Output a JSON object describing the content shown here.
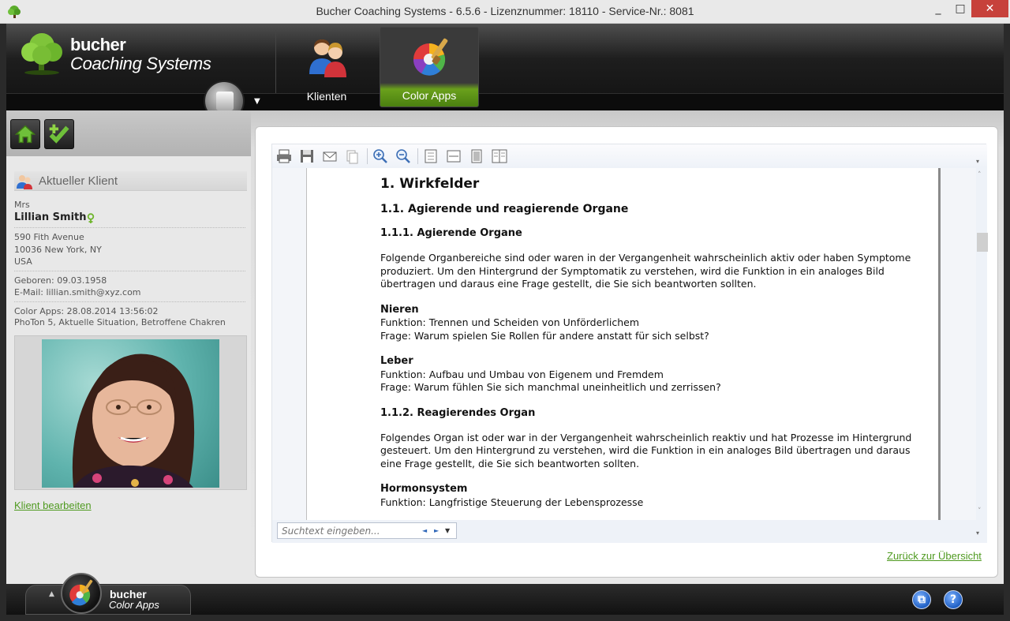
{
  "window": {
    "title": "Bucher Coaching Systems - 6.5.6 - Lizenznummer: 18110 - Service-Nr.: 8081",
    "minimize": "_",
    "maximize": "□",
    "close": "✕"
  },
  "header": {
    "logo_line1": "bucher",
    "logo_line2": "Coaching Systems",
    "system_menu_arrow": "▼",
    "tabs": [
      {
        "label": "Klienten",
        "icon": "clients-icon"
      },
      {
        "label": "Color Apps",
        "icon": "color-palette-icon",
        "active": true
      }
    ]
  },
  "sidebar": {
    "section_title": "Aktueller Klient",
    "client": {
      "salutation": "Mrs",
      "name": "Lillian Smith",
      "street": "590 Fith Avenue",
      "city": "10036 New York, NY",
      "country": "USA",
      "born": "Geboren: 09.03.1958",
      "email": "E-Mail: lillian.smith@xyz.com",
      "color_apps": "Color Apps: 28.08.2014 13:56:02",
      "color_apps_detail": "PhoTon 5, Aktuelle Situation, Betroffene Chakren"
    },
    "edit_link": "Klient bearbeiten"
  },
  "toolbar": {
    "buttons": [
      "print-icon",
      "save-icon",
      "mail-icon",
      "copy-icon",
      "zoom-in-icon",
      "zoom-out-icon",
      "fit-page-icon",
      "fit-width-icon",
      "single-page-icon",
      "two-pages-icon"
    ]
  },
  "document": {
    "h1": "1. Wirkfelder",
    "h2": "1.1. Agierende und reagierende Organe",
    "h3a": "1.1.1. Agierende Organe",
    "p1": "Folgende Organbereiche sind oder waren in der Vergangenheit wahrscheinlich aktiv oder haben Symptome produziert. Um den Hintergrund der Symptomatik zu verstehen, wird die Funktion in ein analoges Bild übertragen und daraus eine Frage gestellt, die Sie sich beantworten sollten.",
    "nieren_head": "Nieren",
    "nieren_func": "Funktion: Trennen und Scheiden von Unförderlichem",
    "nieren_q": "Frage: Warum spielen Sie Rollen für andere anstatt für sich selbst?",
    "leber_head": "Leber",
    "leber_func": "Funktion: Aufbau und Umbau von Eigenem und Fremdem",
    "leber_q": "Frage: Warum fühlen Sie sich manchmal uneinheitlich und zerrissen?",
    "h3b": "1.1.2. Reagierendes Organ",
    "p2": "Folgendes Organ ist oder war in der Vergangenheit wahrscheinlich reaktiv und hat Prozesse im Hintergrund gesteuert. Um den Hintergrund zu verstehen, wird die Funktion in ein analoges Bild übertragen und daraus eine Frage gestellt, die Sie sich beantworten sollten.",
    "hormon_head": "Hormonsystem",
    "hormon_func": "Funktion: Langfristige Steuerung der Lebensprozesse"
  },
  "search": {
    "placeholder": "Suchtext eingeben...",
    "prev": "◄",
    "next": "►",
    "dropdown": "▼"
  },
  "back_link": "Zurück zur Übersicht",
  "footer": {
    "line1": "bucher",
    "line2": "Color Apps",
    "arrow": "▲",
    "window_btn": "⧉",
    "help_btn": "?"
  },
  "colors": {
    "accent_green": "#4f9a20",
    "header_black": "#111111",
    "tab_active_green": "#5c9418"
  }
}
